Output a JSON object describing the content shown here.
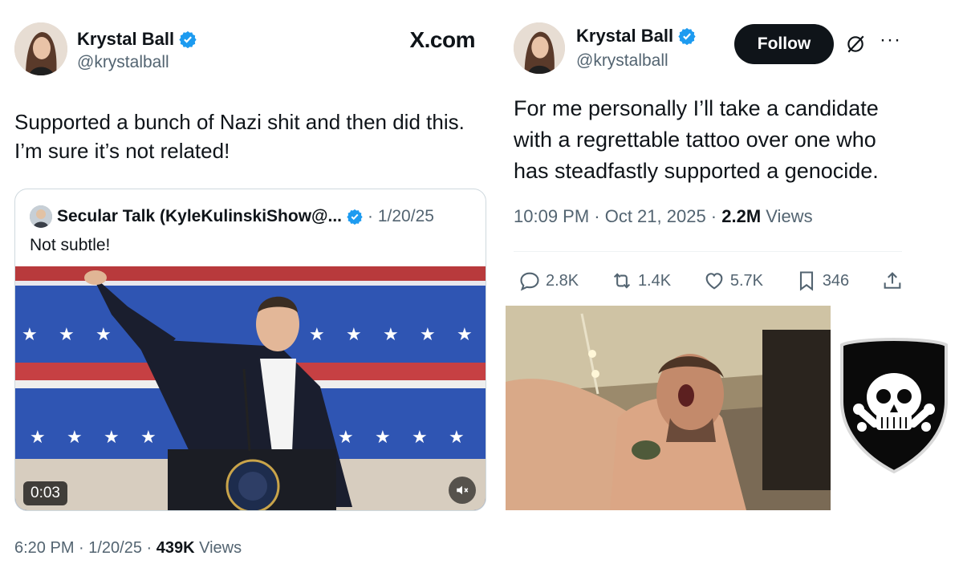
{
  "left_tweet": {
    "author_name": "Krystal Ball",
    "handle": "@krystalball",
    "site_label": "X.com",
    "text_line1": "Supported a bunch of Nazi shit and then did this.",
    "text_line2": "I’m sure it’s not related!",
    "quote": {
      "author": "Secular Talk (KyleKulinskiShow@...",
      "date": "· 1/20/25",
      "text": "Not subtle!",
      "video_duration": "0:03"
    },
    "time_date": "6:20 PM · 1/20/25 · ",
    "views_count": "439K",
    "views_label": " Views"
  },
  "right_tweet": {
    "author_name": "Krystal Ball",
    "handle": "@krystalball",
    "follow_label": "Follow",
    "more_label": "···",
    "text_line1": "For me personally I’ll take a candidate",
    "text_line2": "with a regrettable tattoo over one who",
    "text_line3": "has steadfastly supported a genocide.",
    "time_date": "10:09 PM · Oct 21, 2025 · ",
    "views_count": "2.2M",
    "views_label": " Views",
    "actions": {
      "replies": "2.8K",
      "reposts": "1.4K",
      "likes": "5.7K",
      "bookmarks": "346"
    }
  },
  "colors": {
    "text_primary": "#0f1419",
    "text_secondary": "#536471",
    "verified_blue": "#1d9bf0",
    "border": "#cfd9de"
  },
  "icons": [
    "verified-badge-icon",
    "grok-icon",
    "more-icon",
    "reply-icon",
    "repost-icon",
    "like-icon",
    "bookmark-icon",
    "share-icon",
    "mute-icon"
  ]
}
